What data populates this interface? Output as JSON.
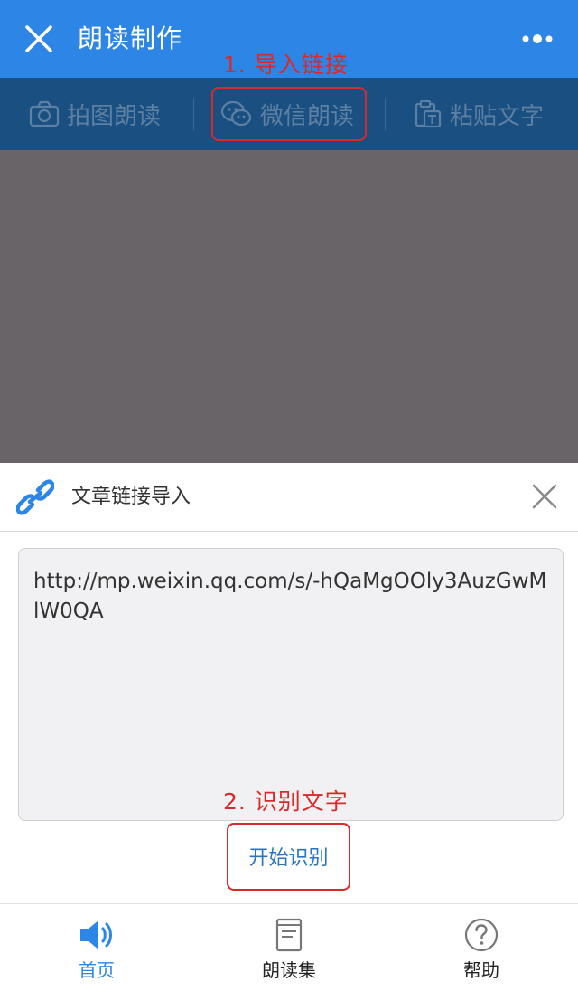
{
  "titlebar": {
    "title": "朗读制作",
    "close_icon": "close-icon",
    "more_icon": "more-dots-icon"
  },
  "tabs": [
    {
      "label": "拍图朗读",
      "icon": "camera-icon"
    },
    {
      "label": "微信朗读",
      "icon": "wechat-icon"
    },
    {
      "label": "粘贴文字",
      "icon": "clipboard-icon"
    }
  ],
  "annotations": {
    "step1": "1. 导入链接",
    "step2": "2. 识别文字"
  },
  "sheet": {
    "title": "文章链接导入",
    "link_icon": "link-icon",
    "input_value": "http://mp.weixin.qq.com/s/-hQaMgOOly3AuzGwMlW0QA",
    "start_label": "开始识别"
  },
  "bottom_nav": [
    {
      "label": "首页",
      "icon": "speaker-icon"
    },
    {
      "label": "朗读集",
      "icon": "book-icon"
    },
    {
      "label": "帮助",
      "icon": "help-icon"
    }
  ],
  "colors": {
    "primary": "#2d86e6",
    "annotation": "#d92a2a",
    "overlay": "#686468"
  }
}
